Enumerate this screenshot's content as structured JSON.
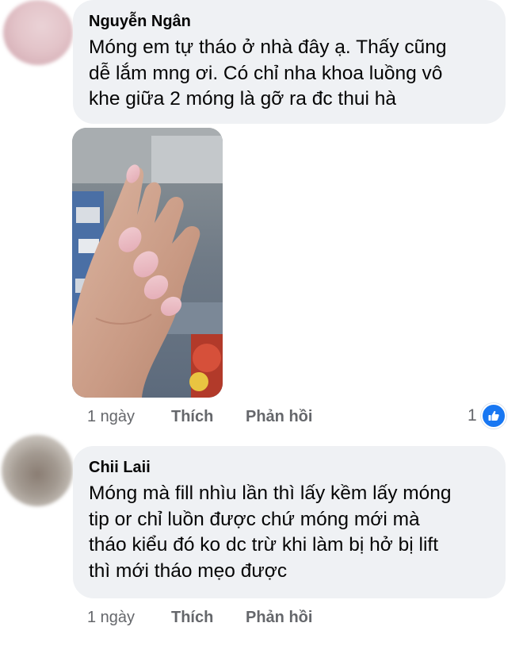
{
  "comments": [
    {
      "author": "Nguyễn Ngân",
      "text_lines": [
        "Móng em tự tháo ở nhà đây ạ. Thấy cũng",
        "dễ lắm mng ơi. Có chỉ nha khoa luồng vô",
        "khe giữa 2 móng là gỡ ra đc thui hà"
      ],
      "has_photo": true,
      "photo_description_icon": "photo-hand-nails",
      "time": "1 ngày",
      "like_label": "Thích",
      "reply_label": "Phản hồi",
      "reaction_count": "1",
      "reaction_icon": "like-icon"
    },
    {
      "author": "Chii Laii",
      "text_lines": [
        "Móng mà fill nhìu lần thì lấy kềm lấy móng",
        "tip or chỉ luồn được chứ móng mới mà",
        "tháo kiểu đó ko dc trừ khi làm bị hở bị lift",
        "thì mới tháo mẹo được"
      ],
      "time": "1 ngày",
      "like_label": "Thích",
      "reply_label": "Phản hồi"
    }
  ],
  "colors": {
    "bubble": "#eff1f4",
    "meta_text": "#65676b",
    "like_blue": "#1877f2"
  }
}
